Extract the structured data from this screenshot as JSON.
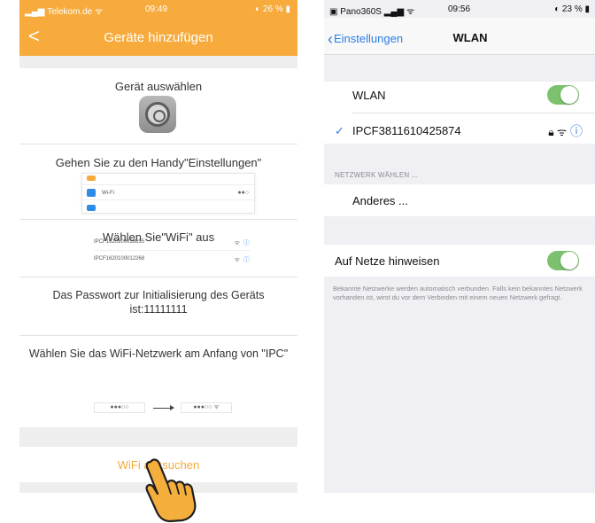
{
  "left": {
    "status": {
      "carrier": "Telekom.de",
      "time": "09:49",
      "battery": "26 %"
    },
    "nav": {
      "back": "<",
      "title": "Geräte hinzufügen"
    },
    "steps": {
      "select_device": "Gerät auswählen",
      "goto_settings": "Gehen Sie zu den Handy\"Einstellungen\"",
      "choose_wifi": "Wählen Sie\"WiFi\" aus",
      "password": "Das Passwort zur Initialisierung des Geräts ist:11111111",
      "choose_network": "Wählen Sie das WiFi-Netzwerk am Anfang von \"IPC\""
    },
    "mini_settings": {
      "wifi_label": "Wi-Fi",
      "right": "●●○"
    },
    "mini_networks": [
      {
        "name": "IPCF1620100033655"
      },
      {
        "name": "IPCF1620100012268"
      }
    ],
    "chips": {
      "left": "●●●○○",
      "right": "●●●○○ ᯤ"
    },
    "button": "WiFi aussuchen"
  },
  "right": {
    "status": {
      "carrier": "Pano360S",
      "time": "09:56",
      "battery": "23 %"
    },
    "nav": {
      "back": "Einstellungen",
      "title": "WLAN"
    },
    "wlan_label": "WLAN",
    "connected_ssid": "IPCF3811610425874",
    "section_header": "NETZWERK WÄHLEN ...",
    "other": "Anderes ...",
    "ask_label": "Auf Netze hinweisen",
    "footer": "Bekannte Netzwerke werden automatisch verbunden. Falls kein bekanntes Netzwerk vorhanden ist, wirst du vor dem Verbinden mit einem neuen Netzwerk gefragt."
  },
  "colors": {
    "accent_orange": "#f6ab3c",
    "ios_blue": "#2d7de4",
    "toggle_green": "#7cc26e"
  }
}
